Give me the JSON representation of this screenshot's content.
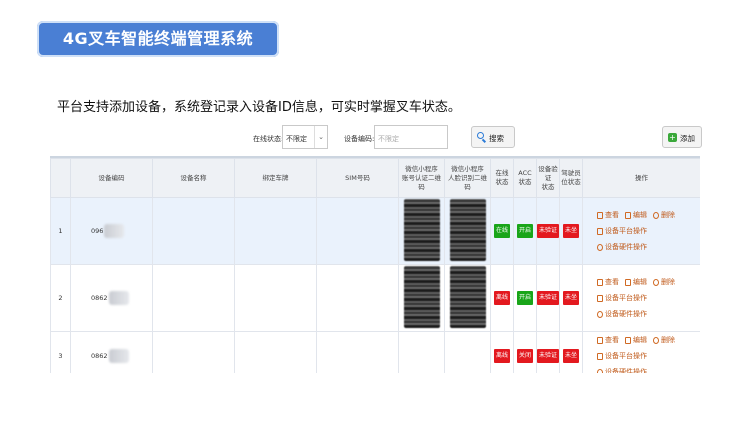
{
  "title": "4G叉车智能终端管理系统",
  "subtitle": "平台支持添加设备，系统登记录入设备ID信息，可实时掌握叉车状态。",
  "filters": {
    "online_label": "在线状态:",
    "online_value": "不限定",
    "device_label": "设备编码:",
    "device_placeholder": "不限定",
    "search_label": "搜索",
    "add_label": "添加"
  },
  "table": {
    "headers": {
      "idx": "",
      "code": "设备编码",
      "name": "设备名称",
      "plate": "绑定车牌",
      "sim": "SIM号码",
      "qr_account_1": "微信小程序",
      "qr_account_2": "账号认证二维码",
      "qr_face_1": "微信小程序",
      "qr_face_2": "人脸识别二维码",
      "online_1": "在线",
      "online_2": "状态",
      "acc_1": "ACC",
      "acc_2": "状态",
      "verify_1": "设备验证",
      "verify_2": "状态",
      "driver_1": "驾驶员",
      "driver_2": "位状态",
      "ops": "操作"
    },
    "rows": [
      {
        "idx": "1",
        "code": "096",
        "online": "在线",
        "acc": "开启",
        "verify": "未验证",
        "driver": "未坐"
      },
      {
        "idx": "2",
        "code": "0862",
        "online": "离线",
        "acc": "开启",
        "verify": "未验证",
        "driver": "未坐"
      },
      {
        "idx": "3",
        "code": "0862",
        "online": "离线",
        "acc": "关闭",
        "verify": "未验证",
        "driver": "未坐"
      }
    ],
    "ops": {
      "view": "查看",
      "edit": "编辑",
      "delete": "删除",
      "platform": "设备平台操作",
      "hardware": "设备硬件操作"
    }
  }
}
